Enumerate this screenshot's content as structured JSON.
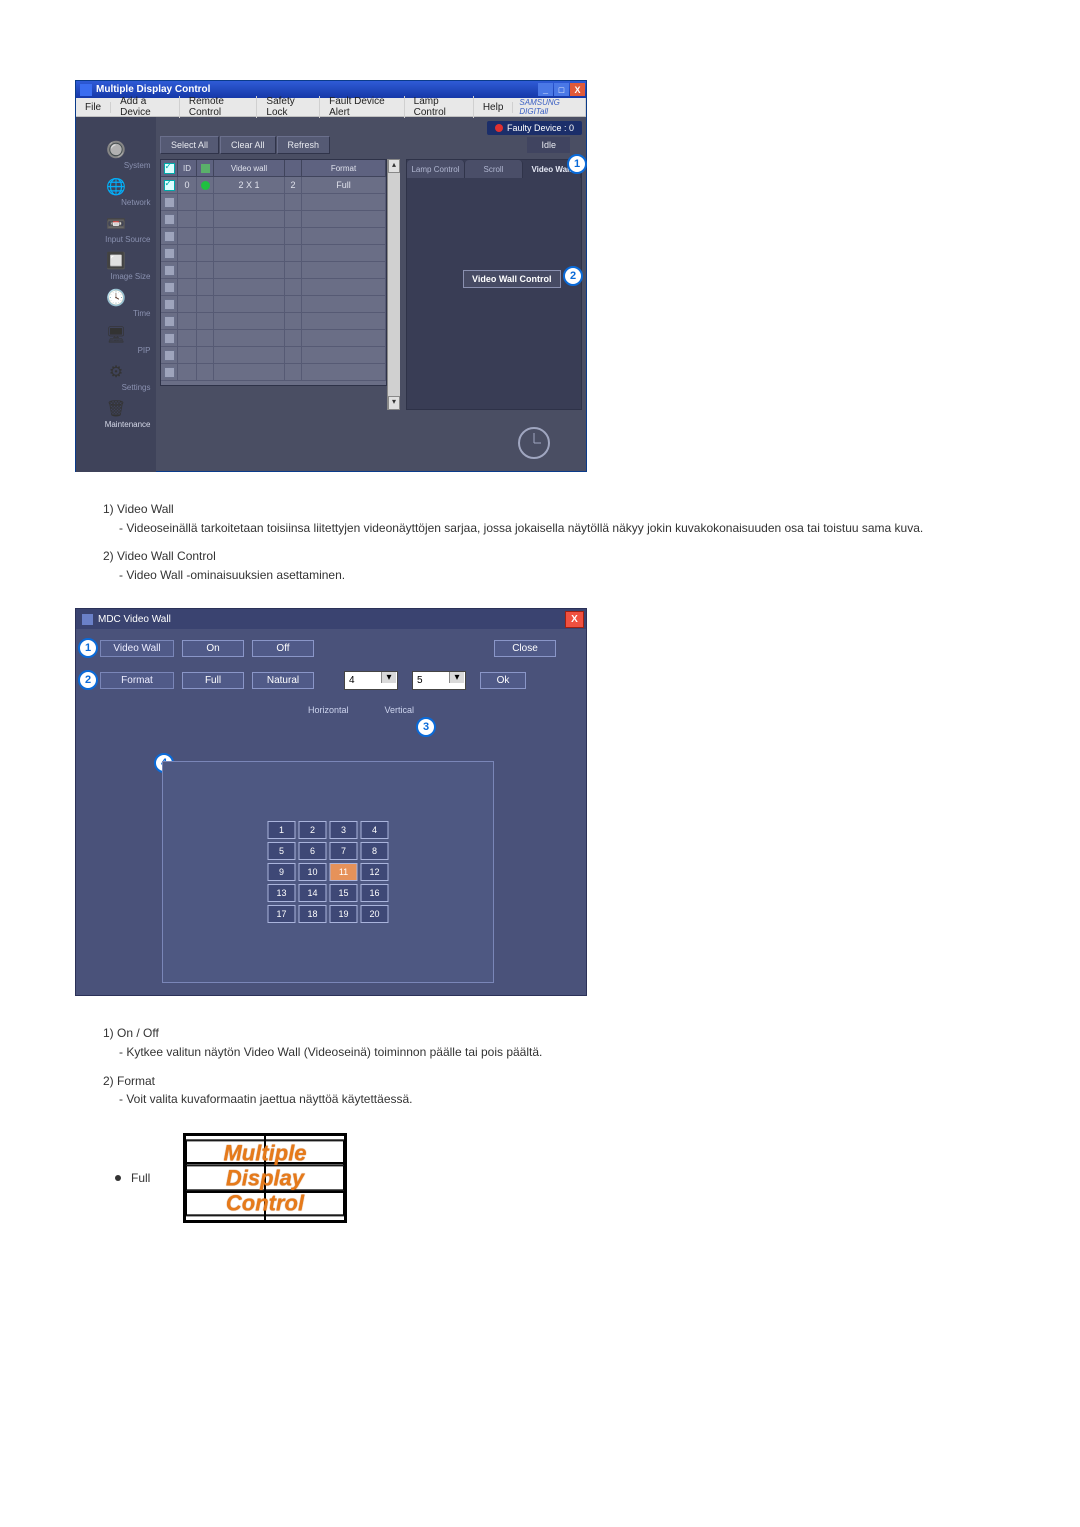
{
  "screenshot1": {
    "window_title": "Multiple Display Control",
    "menubar": [
      "File",
      "Add a Device",
      "Remote Control",
      "Safety Lock",
      "Fault Device Alert",
      "Lamp Control",
      "Help"
    ],
    "brand": "SAMSUNG DIGITall",
    "faulty_badge": "Faulty Device : 0",
    "toolbar": {
      "select_all": "Select All",
      "clear_all": "Clear All",
      "refresh": "Refresh",
      "idle": "Idle"
    },
    "sidebar": [
      {
        "label": "System",
        "icon": "🅒"
      },
      {
        "label": "Network",
        "icon": "🌐"
      },
      {
        "label": "Input Source",
        "icon": "📹"
      },
      {
        "label": "Image Size",
        "icon": "🔲"
      },
      {
        "label": "Time",
        "icon": "🕘"
      },
      {
        "label": "PIP",
        "icon": "🖥"
      },
      {
        "label": "Settings",
        "icon": "⚙"
      },
      {
        "label": "Maintenance",
        "icon": "🗑"
      }
    ],
    "table": {
      "headers": {
        "chk": "☑",
        "id": "ID",
        "m": "",
        "video_wall": "Video wall",
        "n": "",
        "format": "Format"
      },
      "first_row": {
        "id": "0",
        "video_wall": "2 X 1",
        "n": "2",
        "format": "Full"
      }
    },
    "right_tabs": [
      "Lamp Control",
      "Scroll",
      "Video Wall"
    ],
    "video_wall_control_btn": "Video Wall Control",
    "callout1": "1",
    "callout2": "2"
  },
  "desc1": [
    {
      "num": "1)",
      "title": "Video Wall",
      "sub": "- Videoseinällä tarkoitetaan toisiinsa liitettyjen videonäyttöjen sarjaa, jossa jokaisella näytöllä näkyy jokin kuvakokonaisuuden osa tai toistuu sama kuva."
    },
    {
      "num": "2)",
      "title": "Video Wall Control",
      "sub": "- Video Wall -ominaisuuksien asettaminen."
    }
  ],
  "screenshot2": {
    "window_title": "MDC Video Wall",
    "labels": {
      "video_wall": "Video Wall",
      "format": "Format"
    },
    "btns": {
      "on": "On",
      "off": "Off",
      "full": "Full",
      "natural": "Natural",
      "close": "Close",
      "ok": "Ok"
    },
    "select": {
      "h": "4",
      "v": "5",
      "hlabel": "Horizontal",
      "vlabel": "Vertical"
    },
    "cells": [
      "1",
      "2",
      "3",
      "4",
      "5",
      "6",
      "7",
      "8",
      "9",
      "10",
      "11",
      "12",
      "13",
      "14",
      "15",
      "16",
      "17",
      "18",
      "19",
      "20"
    ],
    "callouts": {
      "c1": "1",
      "c2": "2",
      "c3": "3",
      "c4": "4"
    }
  },
  "desc2": [
    {
      "num": "1)",
      "title": "On / Off",
      "sub": "- Kytkee valitun näytön Video Wall (Videoseinä) toiminnon päälle tai pois päältä."
    },
    {
      "num": "2)",
      "title": "Format",
      "sub": "- Voit valita kuvaformaatin jaettua näyttöä käytettäessä."
    }
  ],
  "format_example": {
    "label": "Full",
    "line1": "Multiple",
    "line2": "Display",
    "line3": "Control"
  }
}
